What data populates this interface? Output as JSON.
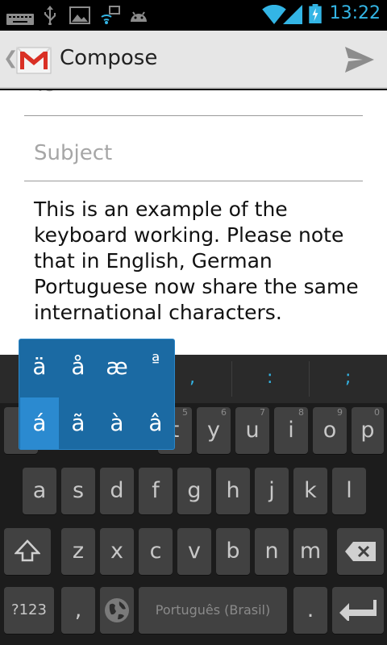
{
  "status_bar": {
    "time": "13:22"
  },
  "action_bar": {
    "title": "Compose"
  },
  "compose": {
    "to_placeholder": "To",
    "subject_placeholder": "Subject",
    "body": "This is an example of the keyboard working. Please note that in English, German Portuguese now share the same international characters."
  },
  "keyboard": {
    "suggestions": [
      ",",
      ":",
      ";"
    ],
    "accents_row1": [
      "ä",
      "å",
      "æ",
      "ª"
    ],
    "accents_row2": [
      "á",
      "ã",
      "à",
      "â"
    ],
    "row1": [
      {
        "label": "t",
        "hint": "5"
      },
      {
        "label": "y",
        "hint": "6"
      },
      {
        "label": "u",
        "hint": "7"
      },
      {
        "label": "i",
        "hint": "8"
      },
      {
        "label": "o",
        "hint": "9"
      },
      {
        "label": "p",
        "hint": "0"
      }
    ],
    "row2": [
      "a",
      "s",
      "d",
      "f",
      "g",
      "h",
      "j",
      "k",
      "l"
    ],
    "row3": [
      "z",
      "x",
      "c",
      "v",
      "b",
      "n",
      "m"
    ],
    "symbols_label": "?123",
    "comma_label": ",",
    "space_label": "Português (Brasil)",
    "period_label": "."
  }
}
